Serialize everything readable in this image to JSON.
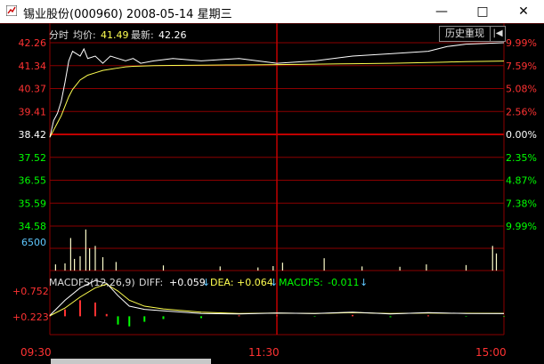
{
  "window": {
    "title": "锡业股份(000960) 2008-05-14 星期三",
    "minimize_glyph": "—",
    "maximize_glyph": "□",
    "close_glyph": "✕"
  },
  "header": {
    "mode_label": "分时",
    "avg_label": "均价:",
    "avg_value": "41.49",
    "last_label": "最新:",
    "last_value": "42.26",
    "history_button": "历史重现",
    "back_icon": "back-to-start-icon",
    "back_glyph": "|◀"
  },
  "price_axis": {
    "left": [
      "42.26",
      "41.34",
      "40.37",
      "39.41",
      "38.42",
      "37.52",
      "36.55",
      "35.59",
      "34.58"
    ],
    "right": [
      "9.99%",
      "7.59%",
      "5.08%",
      "2.56%",
      "0.00%",
      "2.35%",
      "4.87%",
      "7.38%",
      "9.99%"
    ],
    "colors": {
      "up": "#ff3232",
      "base": "#ffffff",
      "down": "#00ff00"
    }
  },
  "volume_axis": {
    "label": "6500",
    "color": "#5fc8ff"
  },
  "macd": {
    "title": "MACDFS(12,26,9)",
    "diff_label": "DIFF:",
    "diff_value": "+0.059",
    "dea_label": "DEA:",
    "dea_value": "+0.064",
    "macdfs_label": "MACDFS:",
    "macdfs_value": "-0.011",
    "arrow": "↓",
    "axis": [
      "+0.752",
      "+0.223"
    ]
  },
  "time_axis": [
    "09:30",
    "11:30",
    "15:00"
  ],
  "chart_data": {
    "type": "line",
    "price": {
      "base": 38.42,
      "ylim": [
        34.58,
        42.26
      ],
      "t": [
        0,
        2,
        4,
        6,
        8,
        10,
        12,
        14,
        16,
        18,
        20,
        24,
        28,
        32,
        36,
        40,
        44,
        48,
        55,
        65,
        80,
        100,
        120,
        140,
        160,
        180,
        200,
        210,
        220,
        240
      ],
      "last": [
        38.3,
        39.0,
        39.3,
        39.8,
        40.6,
        41.5,
        41.9,
        41.8,
        41.7,
        42.0,
        41.6,
        41.7,
        41.4,
        41.7,
        41.6,
        41.5,
        41.6,
        41.4,
        41.5,
        41.6,
        41.5,
        41.6,
        41.4,
        41.5,
        41.7,
        41.8,
        41.9,
        42.1,
        42.2,
        42.26
      ],
      "avg": [
        38.3,
        38.6,
        38.9,
        39.2,
        39.6,
        40.0,
        40.3,
        40.5,
        40.7,
        40.8,
        40.9,
        41.0,
        41.1,
        41.15,
        41.2,
        41.25,
        41.27,
        41.28,
        41.3,
        41.31,
        41.32,
        41.33,
        41.34,
        41.36,
        41.38,
        41.4,
        41.43,
        41.45,
        41.47,
        41.49
      ]
    },
    "volume": {
      "ylim": [
        0,
        13000
      ],
      "t": [
        3,
        8,
        11,
        13,
        16,
        19,
        21,
        24,
        28,
        35,
        60,
        90,
        110,
        118,
        123,
        145,
        165,
        185,
        199,
        220,
        234,
        236
      ],
      "values": [
        1800,
        2100,
        9500,
        3400,
        4200,
        12000,
        6500,
        7200,
        3900,
        2500,
        1500,
        1200,
        900,
        1300,
        2300,
        3600,
        1200,
        1100,
        1800,
        1600,
        7200,
        5000
      ]
    },
    "macd": {
      "ylim": [
        -0.4,
        0.9
      ],
      "t": [
        0,
        8,
        16,
        24,
        30,
        36,
        42,
        50,
        60,
        80,
        100,
        120,
        140,
        160,
        180,
        200,
        220,
        240
      ],
      "diff": [
        0.02,
        0.35,
        0.62,
        0.78,
        0.72,
        0.45,
        0.22,
        0.15,
        0.12,
        0.06,
        0.05,
        0.07,
        0.06,
        0.09,
        0.05,
        0.08,
        0.06,
        0.059
      ],
      "dea": [
        0.01,
        0.18,
        0.42,
        0.62,
        0.7,
        0.55,
        0.35,
        0.22,
        0.16,
        0.09,
        0.06,
        0.07,
        0.06,
        0.08,
        0.06,
        0.07,
        0.065,
        0.064
      ],
      "bars": [
        0.02,
        0.15,
        0.35,
        0.3,
        0.05,
        -0.18,
        -0.22,
        -0.12,
        -0.06,
        -0.04,
        0.02,
        0.02,
        -0.01,
        0.03,
        -0.02,
        0.02,
        -0.01,
        -0.011
      ]
    }
  }
}
